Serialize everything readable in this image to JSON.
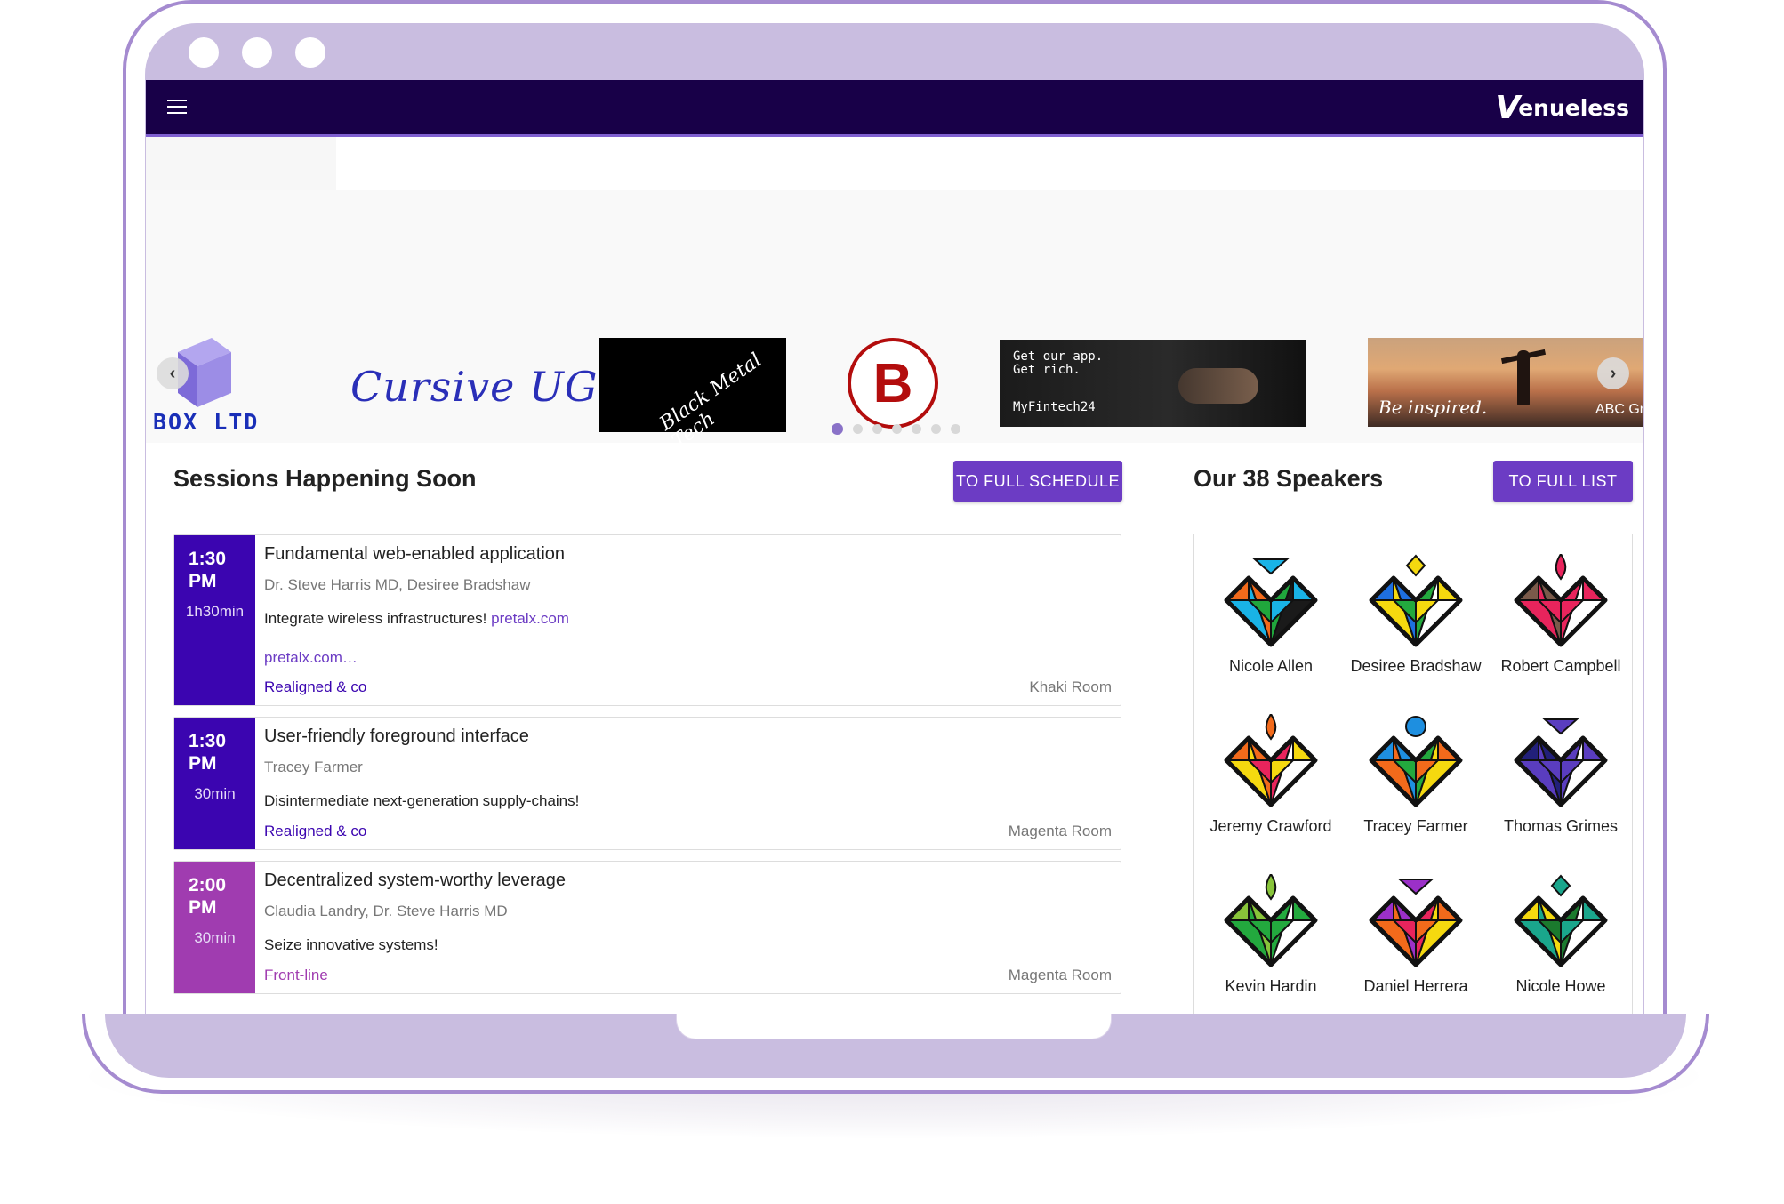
{
  "app": {
    "logo_text": "enueless",
    "logo_initial": "V"
  },
  "sponsors": {
    "box_ltd": "BOX LTD",
    "cursive": "Cursive UG",
    "black_metal": "Black Metal Tech",
    "b_logo": "B",
    "fintech_line1": "Get our app.\nGet rich.",
    "fintech_line2": "MyFintech24",
    "inspired_line1": "Be inspired.",
    "inspired_line2": "ABC Gm",
    "pager_count": 7,
    "pager_active": 0
  },
  "sessions_section": {
    "title": "Sessions Happening Soon",
    "button": "TO FULL SCHEDULE",
    "items": [
      {
        "time": "1:30\nPM",
        "duration": "1h30min",
        "title": "Fundamental web-enabled application",
        "speakers": "Dr. Steve Harris MD, Desiree Bradshaw",
        "abstract": "Integrate wireless infrastructures! ",
        "abstract_link": "pretalx.com",
        "more": "pretalx.com…",
        "track": "Realigned & co",
        "room": "Khaki Room",
        "color": "#3b05b0"
      },
      {
        "time": "1:30\nPM",
        "duration": "30min",
        "title": "User-friendly foreground interface",
        "speakers": "Tracey Farmer",
        "abstract": "Disintermediate next-generation supply-chains!",
        "abstract_link": "",
        "more": "",
        "track": "Realigned & co",
        "room": "Magenta Room",
        "color": "#3b05b0"
      },
      {
        "time": "2:00\nPM",
        "duration": "30min",
        "title": "Decentralized system-worthy leverage",
        "speakers": "Claudia Landry, Dr. Steve Harris MD",
        "abstract": "Seize innovative systems!",
        "abstract_link": "",
        "more": "",
        "track": "Front-line",
        "room": "Magenta Room",
        "color": "#a03cb0"
      }
    ]
  },
  "speakers_section": {
    "title": "Our 38 Speakers",
    "button": "TO FULL LIST",
    "items": [
      {
        "name": "Nicole Allen",
        "colors": [
          "#19b3e6",
          "#f26a1b",
          "#20a63c",
          "#1a1a1a"
        ],
        "top": "triangle",
        "top_color": "#19b3e6"
      },
      {
        "name": "Desiree Bradshaw",
        "colors": [
          "#f5d90f",
          "#1e6fe0",
          "#23a93e",
          "#ffffff"
        ],
        "top": "diamond",
        "top_color": "#f5d90f"
      },
      {
        "name": "Robert Campbell",
        "colors": [
          "#e8245c",
          "#7a5a4a",
          "#e8245c",
          "#ffffff"
        ],
        "top": "flame",
        "top_color": "#e8245c"
      },
      {
        "name": "Jeremy Crawford",
        "colors": [
          "#f5d90f",
          "#f26a1b",
          "#e8245c",
          "#ffffff"
        ],
        "top": "flame",
        "top_color": "#f26a1b"
      },
      {
        "name": "Tracey Farmer",
        "colors": [
          "#f26a1b",
          "#1e8fe0",
          "#23a93e",
          "#f5d90f"
        ],
        "top": "circle",
        "top_color": "#1e8fe0"
      },
      {
        "name": "Thomas Grimes",
        "colors": [
          "#5a3dbf",
          "#22207a",
          "#5a3dbf",
          "#ffffff"
        ],
        "top": "triangle",
        "top_color": "#5a3dbf"
      },
      {
        "name": "Kevin Hardin",
        "colors": [
          "#23a93e",
          "#88c43a",
          "#23a93e",
          "#ffffff"
        ],
        "top": "flame",
        "top_color": "#88c43a"
      },
      {
        "name": "Daniel Herrera",
        "colors": [
          "#f26a1b",
          "#9b30c8",
          "#e8245c",
          "#f5d90f"
        ],
        "top": "triangle",
        "top_color": "#9b30c8"
      },
      {
        "name": "Nicole Howe",
        "colors": [
          "#1aa68c",
          "#f5d90f",
          "#1b7a2e",
          "#ffffff"
        ],
        "top": "diamond",
        "top_color": "#1aa68c"
      }
    ]
  }
}
